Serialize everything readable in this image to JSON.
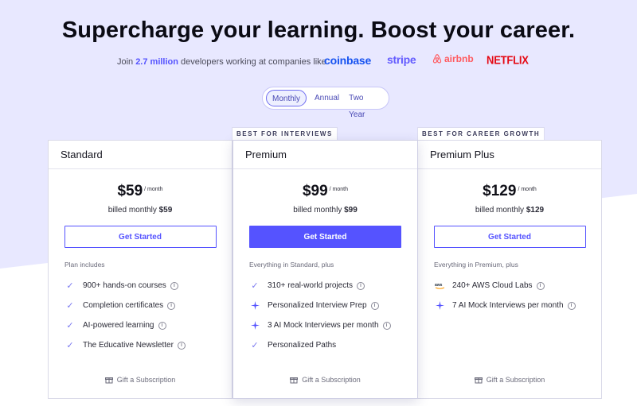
{
  "header": {
    "title": "Supercharge your learning. Boost your career.",
    "social_prefix": "Join",
    "social_count": "2.7 million",
    "social_suffix": "developers working at companies like",
    "logos": [
      "coinbase",
      "stripe",
      "airbnb",
      "NETFLIX"
    ]
  },
  "billing_toggle": {
    "options": [
      "Monthly",
      "Annual",
      "Two Year"
    ],
    "selected": "Monthly"
  },
  "ribbons": {
    "premium": "BEST FOR INTERVIEWS",
    "premium_plus": "BEST FOR CAREER GROWTH"
  },
  "plans": [
    {
      "name": "Standard",
      "price": "$59",
      "period": "/ month",
      "billed_label": "billed monthly",
      "billed_amount": "$59",
      "cta": "Get Started",
      "includes": "Plan includes",
      "features": [
        {
          "text": "900+ hands-on courses",
          "icon": "check-icon"
        },
        {
          "text": "Completion certificates",
          "icon": "check-icon"
        },
        {
          "text": "AI-powered learning",
          "icon": "check-icon"
        },
        {
          "text": "The Educative Newsletter",
          "icon": "check-icon"
        }
      ],
      "gift": "Gift a Subscription"
    },
    {
      "name": "Premium",
      "price": "$99",
      "period": "/ month",
      "billed_label": "billed monthly",
      "billed_amount": "$99",
      "cta": "Get Started",
      "includes": "Everything in Standard, plus",
      "features": [
        {
          "text": "310+ real-world projects",
          "icon": "check-icon"
        },
        {
          "text": "Personalized Interview Prep",
          "icon": "sparkle-icon"
        },
        {
          "text": "3 AI Mock Interviews per month",
          "icon": "sparkle-icon"
        },
        {
          "text": "Personalized Paths",
          "icon": "check-icon"
        }
      ],
      "gift": "Gift a Subscription"
    },
    {
      "name": "Premium Plus",
      "price": "$129",
      "period": "/ month",
      "billed_label": "billed monthly",
      "billed_amount": "$129",
      "cta": "Get Started",
      "includes": "Everything in Premium, plus",
      "features": [
        {
          "text": "240+ AWS Cloud Labs",
          "icon": "aws-icon"
        },
        {
          "text": "7 AI Mock Interviews per month",
          "icon": "sparkle-icon"
        }
      ],
      "gift": "Gift a Subscription"
    }
  ],
  "colors": {
    "accent": "#5553ff",
    "background_band": "#e8e8ff",
    "check": "#7a78f0"
  }
}
